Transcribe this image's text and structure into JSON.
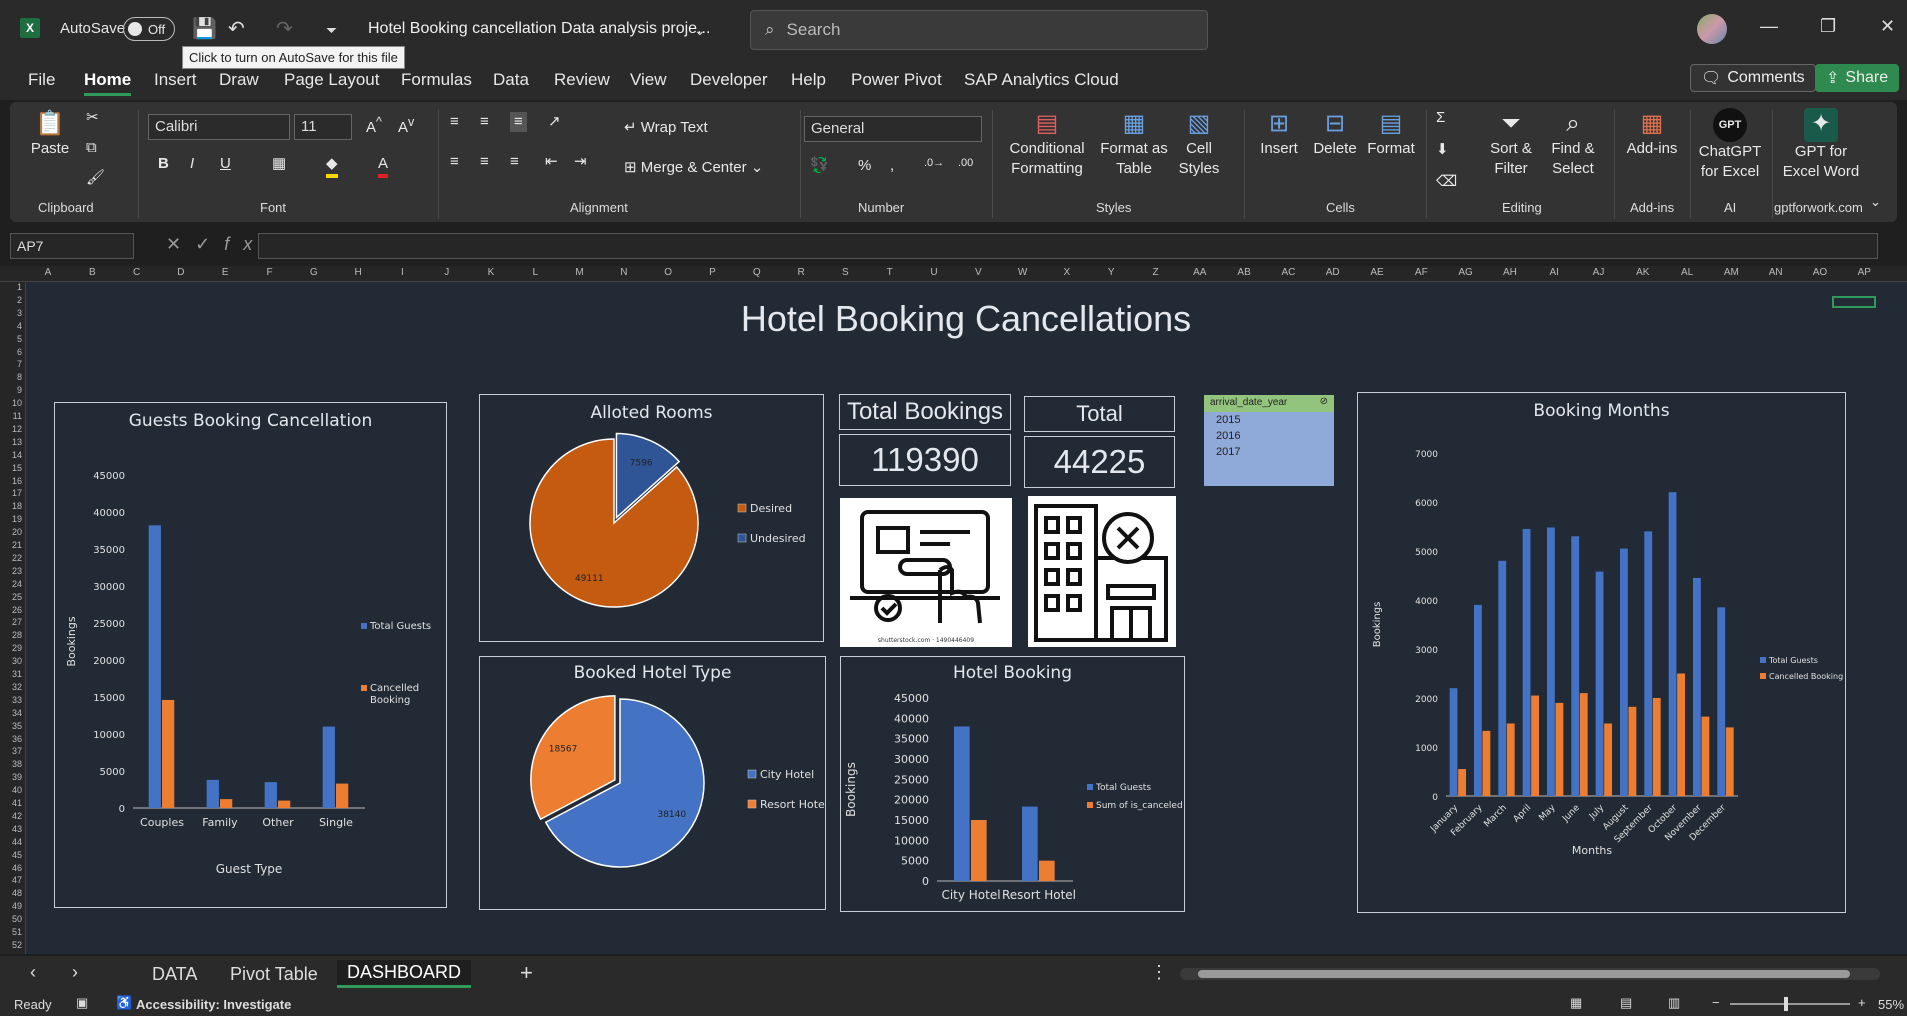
{
  "titlebar": {
    "autosave_label": "AutoSave",
    "autosave_state": "Off",
    "doc_title": "Hotel Booking cancellation Data analysis proje...",
    "search_placeholder": "Search",
    "tooltip": "Click to turn on AutoSave for this file"
  },
  "menu": [
    "File",
    "Home",
    "Insert",
    "Draw",
    "Page Layout",
    "Formulas",
    "Data",
    "Review",
    "View",
    "Developer",
    "Help",
    "Power Pivot",
    "SAP Analytics Cloud"
  ],
  "comments_label": "Comments",
  "share_label": "Share",
  "ribbon": {
    "paste": "Paste",
    "clipboard": "Clipboard",
    "font_name": "Calibri",
    "font_size": "11",
    "font": "Font",
    "wrap_text": "Wrap Text",
    "merge_center": "Merge & Center",
    "alignment": "Alignment",
    "number_format": "General",
    "number": "Number",
    "cond_format": "Conditional\nFormatting",
    "format_table": "Format as\nTable",
    "cell_styles": "Cell\nStyles",
    "styles": "Styles",
    "insert": "Insert",
    "delete": "Delete",
    "format": "Format",
    "cells": "Cells",
    "sort_filter": "Sort &\nFilter",
    "find_select": "Find &\nSelect",
    "editing": "Editing",
    "addins": "Add-ins",
    "addins_group": "Add-ins",
    "chatgpt": "ChatGPT\nfor Excel",
    "ai": "AI",
    "gpt_word": "GPT for\nExcel Word",
    "gptforwork": "gptforwork.com"
  },
  "formula": {
    "name_box": "AP7",
    "content": ""
  },
  "columns": [
    "A",
    "B",
    "C",
    "D",
    "E",
    "F",
    "G",
    "H",
    "I",
    "J",
    "K",
    "L",
    "M",
    "N",
    "O",
    "P",
    "Q",
    "R",
    "S",
    "T",
    "U",
    "V",
    "W",
    "X",
    "Y",
    "Z",
    "AA",
    "AB",
    "AC",
    "AD",
    "AE",
    "AF",
    "AG",
    "AH",
    "AI",
    "AJ",
    "AK",
    "AL",
    "AM",
    "AN",
    "AO",
    "AP"
  ],
  "dashboard": {
    "title": "Hotel Booking Cancellations",
    "total_bookings_label": "Total Bookings",
    "total_bookings_value": "119390",
    "total_label": "Total",
    "total_value": "44225",
    "slicer_title": "arrival_date_year",
    "slicer_items": [
      "2015",
      "2016",
      "2017"
    ],
    "image_caption": "shutterstock.com · 1490446409"
  },
  "chart_data": [
    {
      "type": "bar",
      "title": "Guests Booking Cancellation",
      "categories": [
        "Couples",
        "Family",
        "Other",
        "Single"
      ],
      "series": [
        {
          "name": "Total Guests",
          "values": [
            38200,
            3800,
            3500,
            11000
          ],
          "color": "#4472c4"
        },
        {
          "name": "Cancelled\nBooking",
          "values": [
            14600,
            1200,
            1000,
            3300
          ],
          "color": "#ed7d31"
        }
      ],
      "xlabel": "Guest Type",
      "ylabel": "Bookings",
      "yticks": [
        0,
        5000,
        10000,
        15000,
        20000,
        25000,
        30000,
        35000,
        40000,
        45000
      ],
      "ylim": [
        0,
        45000
      ],
      "legend": "right"
    },
    {
      "type": "pie",
      "title": "Alloted Rooms",
      "slices": [
        {
          "name": "Desired",
          "value": 49111,
          "color": "#c55a11"
        },
        {
          "name": "Undesired",
          "value": 7596,
          "color": "#2f5597"
        }
      ],
      "legend": "right"
    },
    {
      "type": "pie",
      "title": "Booked Hotel Type",
      "slices": [
        {
          "name": "City Hotel",
          "value": 38140,
          "color": "#4472c4"
        },
        {
          "name": "Resort Hotel",
          "value": 18567,
          "color": "#ed7d31"
        }
      ],
      "legend": "right"
    },
    {
      "type": "bar",
      "title": "Hotel Booking",
      "categories": [
        "City Hotel",
        "Resort Hotel"
      ],
      "series": [
        {
          "name": "Total Guests",
          "values": [
            38000,
            18300
          ],
          "color": "#4472c4"
        },
        {
          "name": "Sum of is_canceled",
          "values": [
            15000,
            5000
          ],
          "color": "#ed7d31"
        }
      ],
      "ylabel": "Bookings",
      "yticks": [
        0,
        5000,
        10000,
        15000,
        20000,
        25000,
        30000,
        35000,
        40000,
        45000
      ],
      "ylim": [
        0,
        45000
      ],
      "legend": "right"
    },
    {
      "type": "bar",
      "title": "Booking Months",
      "categories": [
        "January",
        "February",
        "March",
        "April",
        "May",
        "June",
        "July",
        "August",
        "September",
        "October",
        "November",
        "December"
      ],
      "series": [
        {
          "name": "Total Guests",
          "values": [
            2200,
            3900,
            4800,
            5450,
            5480,
            5300,
            4580,
            5050,
            5400,
            6200,
            4450,
            3850
          ],
          "color": "#4472c4"
        },
        {
          "name": "Cancelled Booking",
          "values": [
            550,
            1330,
            1480,
            2050,
            1900,
            2100,
            1480,
            1820,
            2000,
            2500,
            1620,
            1400
          ],
          "color": "#ed7d31"
        }
      ],
      "xlabel": "Months",
      "ylabel": "Bookings",
      "yticks": [
        0,
        1000,
        2000,
        3000,
        4000,
        5000,
        6000,
        7000
      ],
      "ylim": [
        0,
        7000
      ],
      "legend": "right"
    }
  ],
  "sheet_tabs": [
    "DATA",
    "Pivot Table",
    "DASHBOARD"
  ],
  "status": {
    "ready": "Ready",
    "accessibility": "Accessibility: Investigate",
    "zoom": "55%"
  }
}
